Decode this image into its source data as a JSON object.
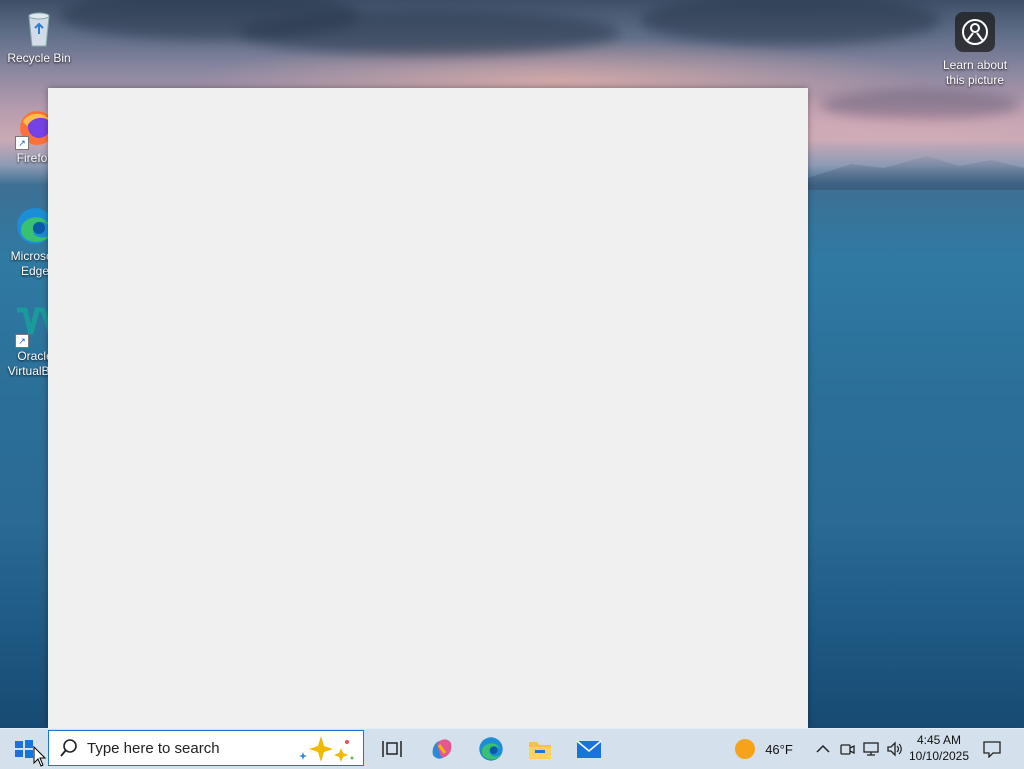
{
  "desktop": {
    "icons": [
      {
        "label": "Recycle Bin",
        "icon": "recycle-bin-icon"
      },
      {
        "label": "Firefox",
        "icon": "firefox-icon"
      },
      {
        "label": "Microsoft Edge",
        "icon": "edge-icon"
      },
      {
        "label": "Oracle VirtualBox",
        "icon": "virtualbox-icon"
      }
    ],
    "learn_about": {
      "label": "Learn about this picture",
      "icon": "camera-icon"
    }
  },
  "window": {
    "title": ""
  },
  "taskbar": {
    "start_icon": "windows-start-icon",
    "search": {
      "placeholder": "Type here to search",
      "icon": "search-icon"
    },
    "pinned": [
      {
        "name": "Task View",
        "icon": "task-view-icon"
      },
      {
        "name": "Copilot",
        "icon": "copilot-icon"
      },
      {
        "name": "Microsoft Edge",
        "icon": "edge-icon"
      },
      {
        "name": "File Explorer",
        "icon": "file-explorer-icon"
      },
      {
        "name": "Mail",
        "icon": "mail-icon"
      }
    ],
    "weather": {
      "temp": "46°F",
      "icon": "weather-sun-icon"
    },
    "tray_icons": [
      "chevron-up-icon",
      "meet-now-icon",
      "network-icon",
      "volume-icon"
    ],
    "clock": {
      "time": "4:45 AM",
      "date": "10/10/2025"
    },
    "notifications_icon": "notification-icon"
  }
}
